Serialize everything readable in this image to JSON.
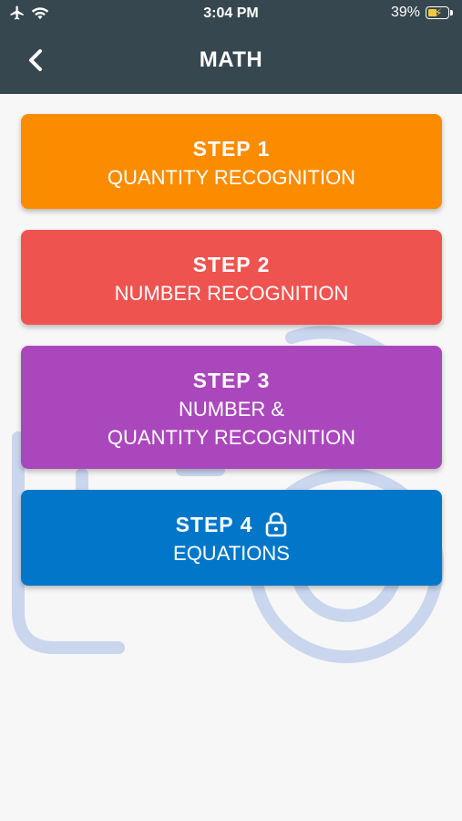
{
  "status_bar": {
    "time": "3:04 PM",
    "battery_percent": "39%",
    "icons": [
      "airplane-icon",
      "wifi-icon",
      "battery-charging-icon"
    ]
  },
  "header": {
    "title": "MATH",
    "back_icon": "chevron-left-icon"
  },
  "steps": [
    {
      "title": "STEP 1",
      "subtitle_lines": [
        "QUANTITY RECOGNITION"
      ],
      "color": "#fb8c00",
      "locked": false
    },
    {
      "title": "STEP 2",
      "subtitle_lines": [
        "NUMBER RECOGNITION"
      ],
      "color": "#ef5350",
      "locked": false
    },
    {
      "title": "STEP 3",
      "subtitle_lines": [
        "NUMBER &",
        "QUANTITY RECOGNITION"
      ],
      "color": "#ab47bc",
      "locked": false
    },
    {
      "title": "STEP 4",
      "subtitle_lines": [
        "EQUATIONS"
      ],
      "color": "#0277c9",
      "locked": true,
      "lock_icon": "lock-icon"
    }
  ],
  "colors": {
    "header_bg": "#37474f",
    "page_bg": "#f7f7f7",
    "background_art": "#c9d6ee"
  }
}
